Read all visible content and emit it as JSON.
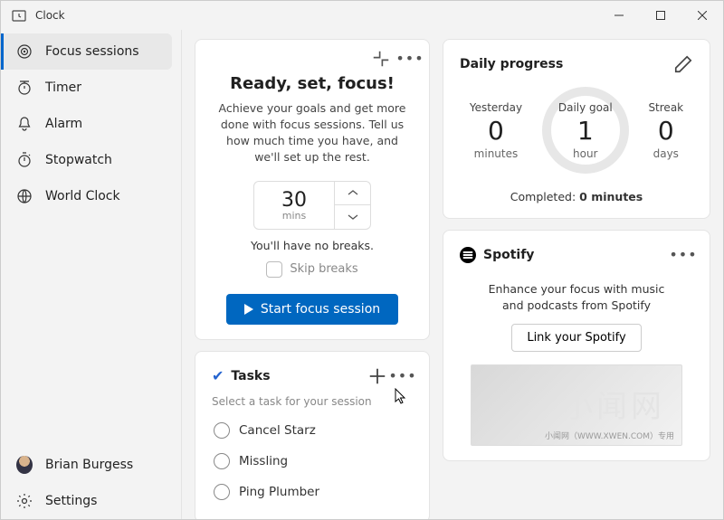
{
  "app": {
    "title": "Clock"
  },
  "window_controls": {
    "min": "min",
    "max": "max",
    "close": "close"
  },
  "sidebar": {
    "items": [
      {
        "label": "Focus sessions",
        "icon": "target"
      },
      {
        "label": "Timer",
        "icon": "timer"
      },
      {
        "label": "Alarm",
        "icon": "bell"
      },
      {
        "label": "Stopwatch",
        "icon": "stopwatch"
      },
      {
        "label": "World Clock",
        "icon": "globe"
      }
    ],
    "user": {
      "name": "Brian Burgess"
    },
    "settings_label": "Settings"
  },
  "focus": {
    "heading": "Ready, set, focus!",
    "description": "Achieve your goals and get more done with focus sessions. Tell us how much time you have, and we'll set up the rest.",
    "duration_value": "30",
    "duration_unit": "mins",
    "breaks_note": "You'll have no breaks.",
    "skip_label": "Skip breaks",
    "start_label": "Start focus session"
  },
  "progress": {
    "title": "Daily progress",
    "yesterday_label": "Yesterday",
    "yesterday_value": "0",
    "yesterday_unit": "minutes",
    "goal_label": "Daily goal",
    "goal_value": "1",
    "goal_unit": "hour",
    "streak_label": "Streak",
    "streak_value": "0",
    "streak_unit": "days",
    "completed_prefix": "Completed: ",
    "completed_value": "0 minutes"
  },
  "spotify": {
    "title": "Spotify",
    "description": "Enhance your focus with music and podcasts from Spotify",
    "link_label": "Link your Spotify",
    "watermark_cn": "小闻网",
    "watermark_url": "小闻网（WWW.XWEN.COM）专用"
  },
  "tasks": {
    "title": "Tasks",
    "subtitle": "Select a task for your session",
    "items": [
      {
        "label": "Cancel Starz"
      },
      {
        "label": "Missling"
      },
      {
        "label": "Ping Plumber"
      }
    ]
  }
}
